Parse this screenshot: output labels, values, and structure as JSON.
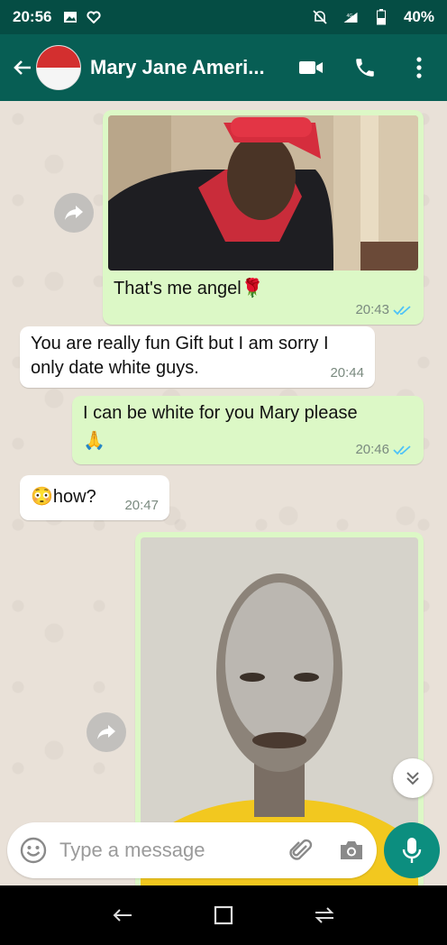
{
  "status_bar": {
    "time": "20:56",
    "battery": "40%",
    "network": "4G"
  },
  "header": {
    "contact_name": "Mary Jane Ameri..."
  },
  "messages": [
    {
      "type": "image",
      "direction": "outgoing",
      "caption": "That's me angel🌹",
      "time": "20:43",
      "status": "read"
    },
    {
      "type": "text",
      "direction": "incoming",
      "line1": "You are really fun Gift but I am sorry I",
      "line2": "only date white guys.",
      "time": "20:44"
    },
    {
      "type": "text",
      "direction": "outgoing",
      "line1": "I can be white for you Mary please",
      "line2": "🙏",
      "time": "20:46",
      "status": "read"
    },
    {
      "type": "text",
      "direction": "incoming",
      "line1": "😳how?",
      "time": "20:47"
    },
    {
      "type": "image",
      "direction": "outgoing"
    }
  ],
  "composer": {
    "placeholder": "Type a message"
  },
  "colors": {
    "header": "#075e54",
    "status_bar": "#054d44",
    "outgoing": "#dcf8c6",
    "incoming": "#ffffff",
    "accent": "#0c8e7f",
    "read_ticks": "#4fc3f7"
  },
  "icons": [
    "back-arrow-icon",
    "video-call-icon",
    "phone-icon",
    "more-options-icon",
    "forward-icon",
    "emoji-icon",
    "attach-icon",
    "camera-icon",
    "mic-icon",
    "scroll-down-icon"
  ]
}
